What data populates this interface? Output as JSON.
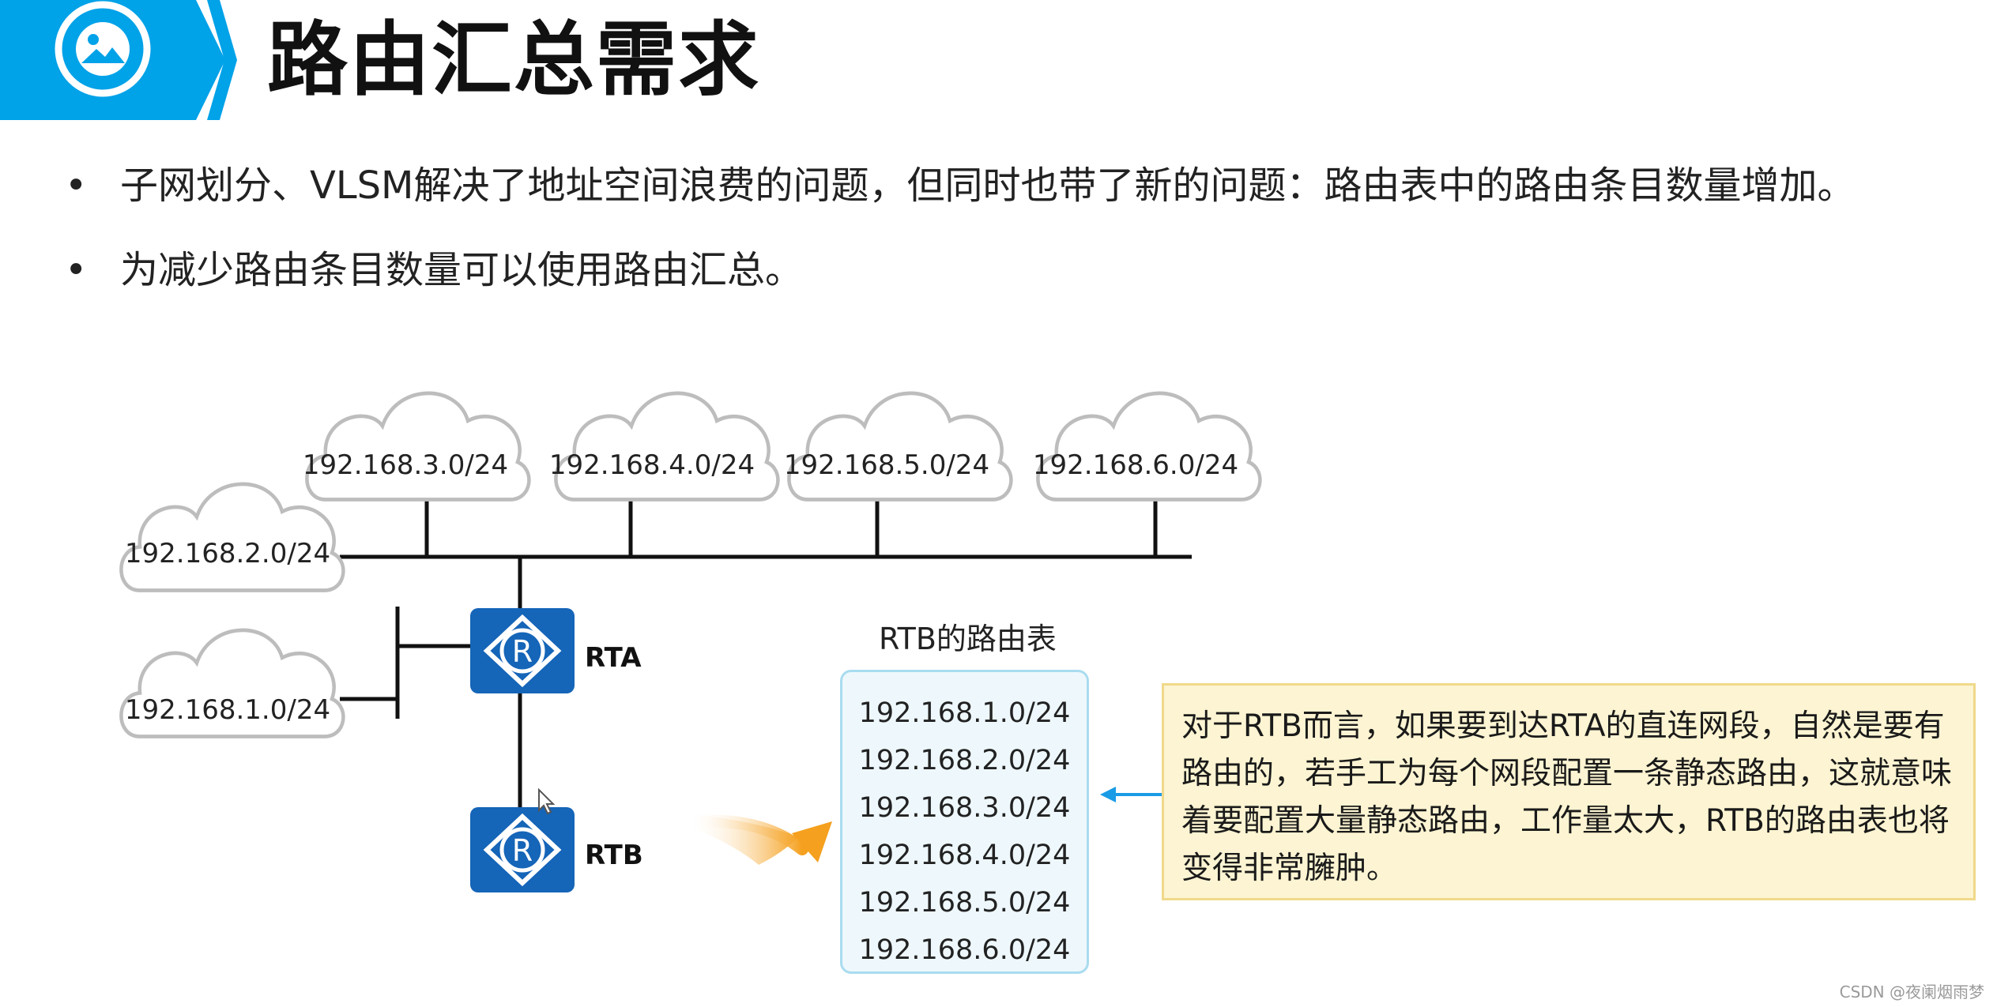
{
  "header": {
    "title": "路由汇总需求",
    "accent_color": "#00a2e8",
    "icon": "image-icon"
  },
  "bullets": [
    "子网划分、VLSM解决了地址空间浪费的问题，但同时也带了新的问题：路由表中的路由条目数量增加。",
    "为减少路由条目数量可以使用路由汇总。"
  ],
  "networks": {
    "net1": "192.168.1.0/24",
    "net2": "192.168.2.0/24",
    "net3": "192.168.3.0/24",
    "net4": "192.168.4.0/24",
    "net5": "192.168.5.0/24",
    "net6": "192.168.6.0/24"
  },
  "routers": {
    "rta": {
      "label": "RTA",
      "icon": "router-icon"
    },
    "rtb": {
      "label": "RTB",
      "icon": "router-icon"
    },
    "color": "#1565b8"
  },
  "route_table": {
    "title": "RTB的路由表",
    "routes": [
      "192.168.1.0/24",
      "192.168.2.0/24",
      "192.168.3.0/24",
      "192.168.4.0/24",
      "192.168.5.0/24",
      "192.168.6.0/24"
    ]
  },
  "note": {
    "text": "对于RTB而言，如果要到达RTA的直连网段，自然是要有路由的，若手工为每个网段配置一条静态路由，这就意味着要配置大量静态路由，工作量太大，RTB的路由表也将变得非常臃肿。"
  },
  "watermark": "CSDN @夜阑烟雨梦"
}
